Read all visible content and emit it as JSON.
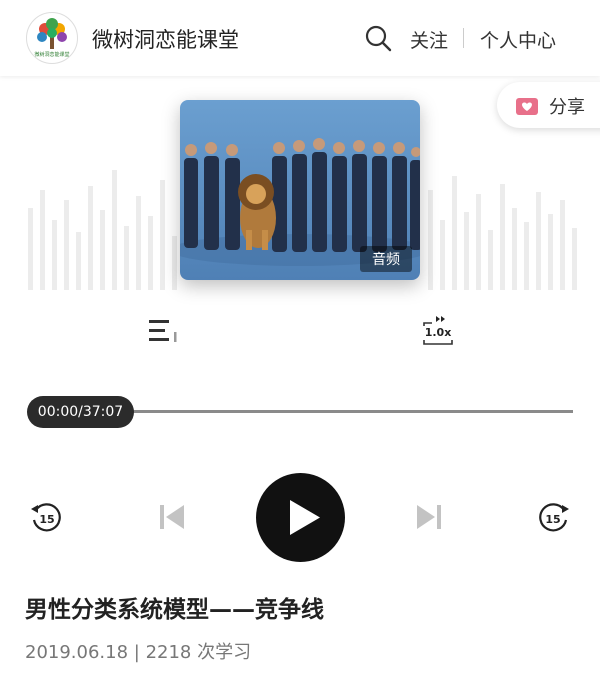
{
  "header": {
    "brand_name": "微树洞恋能课堂",
    "logo_text": "微树洞恋能课堂",
    "follow_label": "关注",
    "personal_center_label": "个人中心"
  },
  "share": {
    "label": "分享"
  },
  "cover": {
    "tag": "音频"
  },
  "player": {
    "speed_label": "1.0x",
    "time_display": "00:00/37:07",
    "progress": 0,
    "skip_seconds_back": "15",
    "skip_seconds_forward": "15"
  },
  "lesson": {
    "title": "男性分类系统模型——竞争线",
    "meta": "2019.06.18 | 2218 次学习"
  },
  "colors": {
    "play_button": "#111111",
    "time_pill": "#2b2b2b",
    "share_icon": "#e8708a",
    "cover_bg": "#5c8fc2"
  }
}
